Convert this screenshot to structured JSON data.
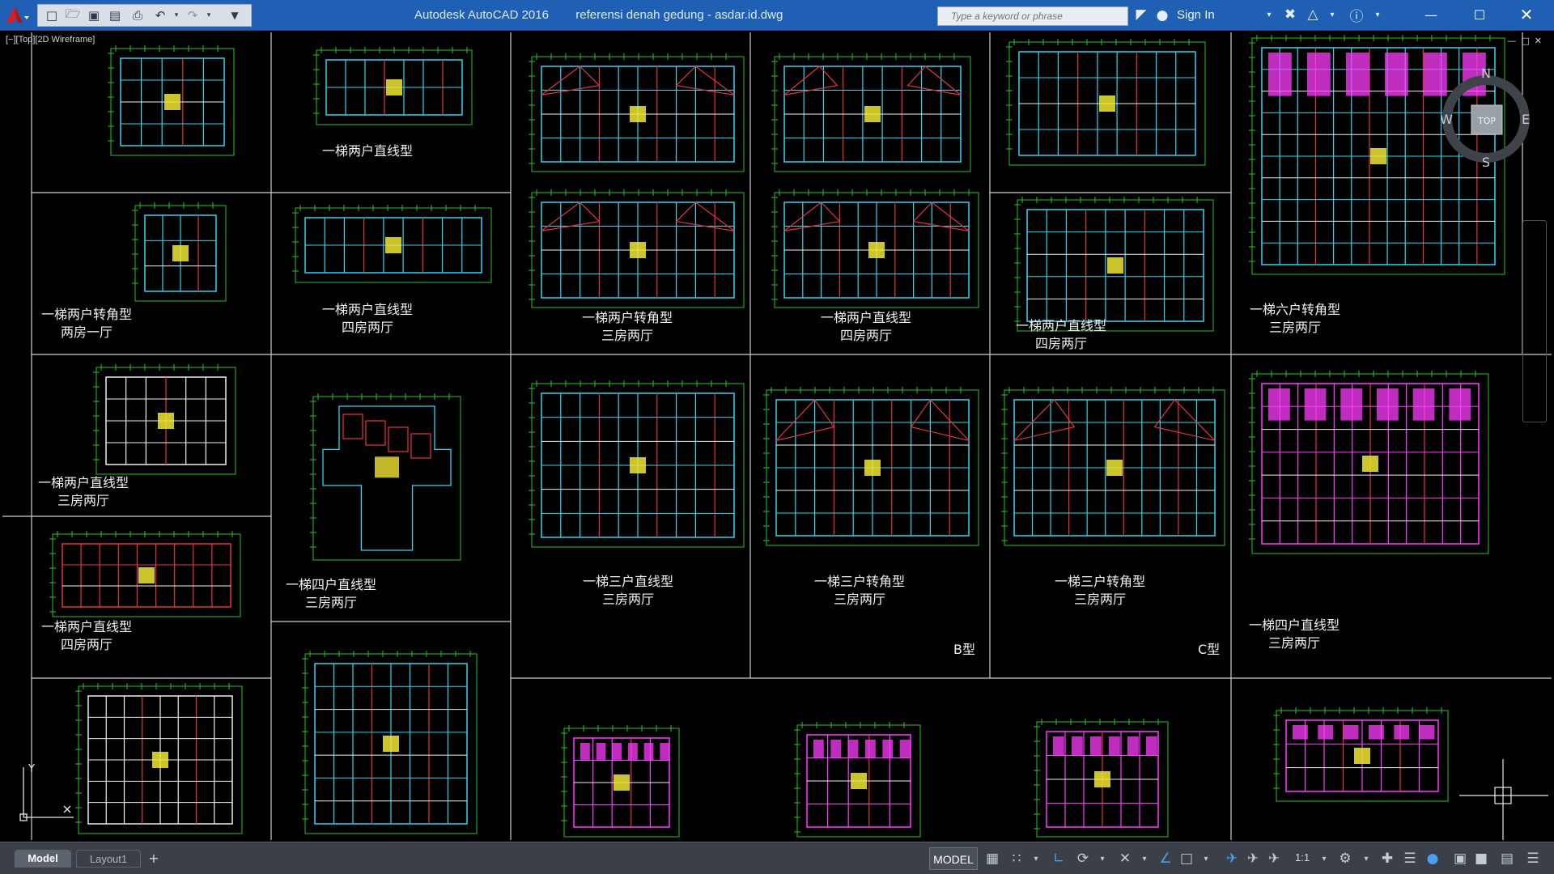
{
  "window": {
    "title": "Autodesk AutoCAD 2016        referensi denah gedung - asdar.id.dwg",
    "search_placeholder": "Type a keyword or phrase",
    "sign_in": "Sign In"
  },
  "viewport": {
    "label": "[−][Top][2D Wireframe]",
    "viewcube": {
      "north": "N",
      "south": "S",
      "east": "E",
      "west": "W",
      "face": "TOP"
    },
    "ucs": {
      "y": "Y",
      "x": "X"
    }
  },
  "plans": [
    {
      "id": "p1",
      "lines": []
    },
    {
      "id": "p2",
      "lines": [
        "一梯两户直线型"
      ]
    },
    {
      "id": "p3",
      "lines": []
    },
    {
      "id": "p4",
      "lines": []
    },
    {
      "id": "p5",
      "lines": []
    },
    {
      "id": "p6",
      "lines": [
        "一梯六户转角型",
        "三房两厅"
      ]
    },
    {
      "id": "p7",
      "lines": [
        "一梯两户转角型",
        "两房一厅"
      ]
    },
    {
      "id": "p8",
      "lines": [
        "一梯两户直线型",
        "四房两厅"
      ]
    },
    {
      "id": "p9",
      "lines": [
        "一梯两户转角型",
        "三房两厅"
      ]
    },
    {
      "id": "p10",
      "lines": [
        "一梯两户直线型",
        "四房两厅"
      ]
    },
    {
      "id": "p11",
      "lines": [
        "一梯两户直线型",
        "四房两厅"
      ]
    },
    {
      "id": "p12",
      "lines": [
        "一梯两户直线型",
        "三房两厅"
      ]
    },
    {
      "id": "p13",
      "lines": [
        "一梯四户直线型",
        "三房两厅"
      ]
    },
    {
      "id": "p14",
      "lines": [
        "一梯三户直线型",
        "三房两厅"
      ]
    },
    {
      "id": "p15",
      "lines": [
        "一梯三户转角型",
        "三房两厅"
      ]
    },
    {
      "id": "p16",
      "lines": [
        "一梯三户转角型",
        "三房两厅"
      ]
    },
    {
      "id": "p17",
      "lines": [
        "一梯四户直线型",
        "三房两厅"
      ]
    },
    {
      "id": "p18",
      "lines": [
        "一梯两户直线型",
        "四房两厅"
      ]
    }
  ],
  "type_tags": {
    "b": "B型",
    "c": "C型"
  },
  "tabs": {
    "model": "Model",
    "layout1": "Layout1",
    "add": "+"
  },
  "status": {
    "model": "MODEL",
    "scale": "1:1"
  },
  "colors": {
    "titlebar": "#1f5fb4",
    "wall_cyan": "#2fd6f0",
    "wall_red": "#e8323c",
    "wall_magenta": "#ff3cff",
    "dim_green": "#26c526",
    "white": "#f0f0f0",
    "yellow": "#f0e632"
  }
}
